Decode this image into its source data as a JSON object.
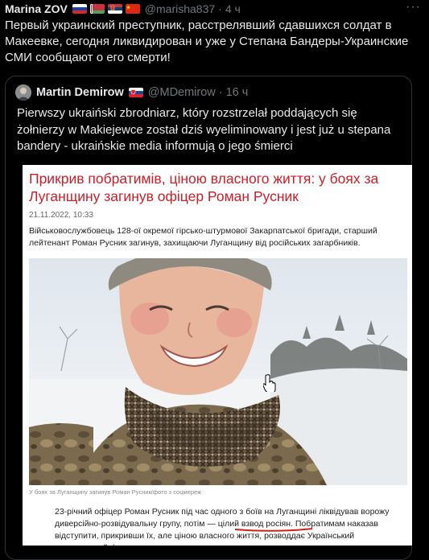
{
  "tweet": {
    "author_name": "Marina ZOV",
    "handle": "@marisha837",
    "time": "4 ч",
    "more": "···",
    "text": "Первый украинский преступник, расстрелявший сдавшихся солдат в Макеевке, сегодня ликвидирован и уже у Степана Бандеры-Украинские СМИ сообщают о его смерти!",
    "flags": [
      "russia-flag-icon",
      "belarus-flag-icon",
      "serbia-flag-icon",
      "china-flag-icon"
    ]
  },
  "quote": {
    "author_name": "Martin Demirow",
    "flag": "slovakia-flag-icon",
    "handle": "@MDemirow",
    "time": "16 ч",
    "text": "Pierwszy ukraiński zbrodniarz, który rozstrzelał poddających się żołnierzy w Makiejewce został dziś wyeliminowany i jest już u stepana bandery - ukraińskie media informują o jego śmierci"
  },
  "article": {
    "title": "Прикрив побратимів, ціною власного життя: у боях за Луганщину загинув офіцер Роман Русник",
    "date": "21.11.2022, 10:33",
    "lead": "Військовослужбовець 128-ої окремої гірсько-штурмової Закарпатської бригади, старший лейтенант Роман Русник загинув, захищаючи Луганщину від російських загарбників.",
    "caption": "У боях за Луганщину загинув Роман Русник/фото з соцмереж",
    "paragraph": "23-річний офіцер Роман Русник під час одного з боїв на Луганщині ліквідував ворожу диверсійно-розвідувальну групу, потім — цілий взвод росіян. Побратимам наказав відступити, прикривши їх, але ціною власного життя, розводдає Український ветеранський фонд."
  },
  "colors": {
    "background": "#000000",
    "text": "#e7e9ea",
    "muted": "#71767b",
    "title_red": "#c8202a",
    "underline": "#d0201a"
  }
}
